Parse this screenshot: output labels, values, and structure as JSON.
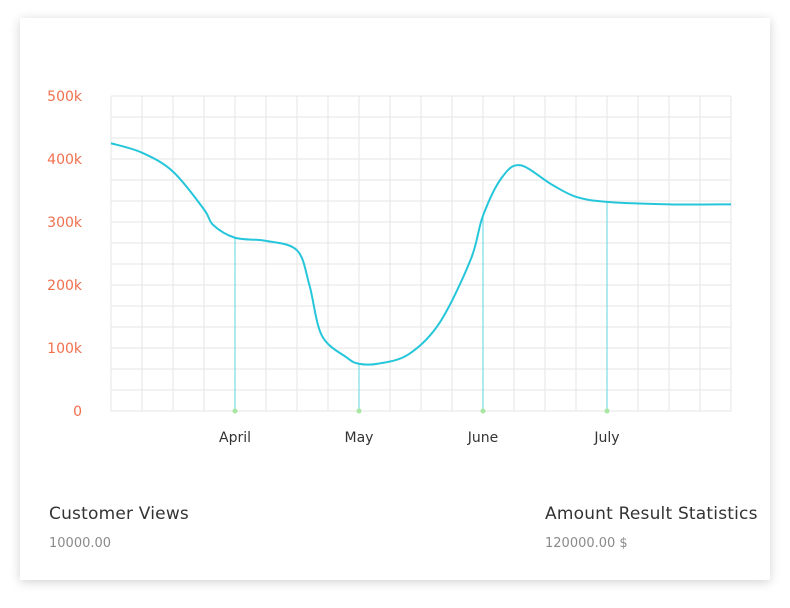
{
  "chart_data": {
    "type": "line",
    "y_ticks": [
      "0",
      "100k",
      "200k",
      "300k",
      "400k",
      "500k"
    ],
    "ylim": [
      0,
      500000
    ],
    "categories": [
      "April",
      "May",
      "June",
      "July"
    ],
    "grid": true,
    "series": [
      {
        "color": "#26c6da",
        "points": [
          [
            0,
            425000
          ],
          [
            0.5,
            410000
          ],
          [
            1.0,
            380000
          ],
          [
            1.5,
            320000
          ],
          [
            1.65,
            295000
          ],
          [
            2.0,
            275000
          ],
          [
            2.5,
            270000
          ],
          [
            3.0,
            255000
          ],
          [
            3.2,
            200000
          ],
          [
            3.4,
            120000
          ],
          [
            3.8,
            85000
          ],
          [
            4.0,
            75000
          ],
          [
            4.3,
            75000
          ],
          [
            4.8,
            90000
          ],
          [
            5.3,
            140000
          ],
          [
            5.8,
            240000
          ],
          [
            6.0,
            310000
          ],
          [
            6.3,
            370000
          ],
          [
            6.6,
            390000
          ],
          [
            7.1,
            360000
          ],
          [
            7.5,
            340000
          ],
          [
            8.0,
            332000
          ],
          [
            9.0,
            328000
          ],
          [
            10.0,
            328000
          ]
        ],
        "markers": [
          {
            "label": "April",
            "x": 2.0,
            "y": 275000
          },
          {
            "label": "May",
            "x": 4.0,
            "y": 75000
          },
          {
            "label": "June",
            "x": 6.0,
            "y": 310000
          },
          {
            "label": "July",
            "x": 8.0,
            "y": 332000
          }
        ]
      }
    ],
    "grid_line_color": "#e6e6e6",
    "drop_line_color": "#5fd4e0",
    "marker_dot_color": "#a8e6a3",
    "y_tick_color": "#f0704e"
  },
  "stats": {
    "left": {
      "title": "Customer Views",
      "value": "10000.00"
    },
    "right": {
      "title": "Amount Result Statistics",
      "value": "120000.00 $"
    }
  }
}
